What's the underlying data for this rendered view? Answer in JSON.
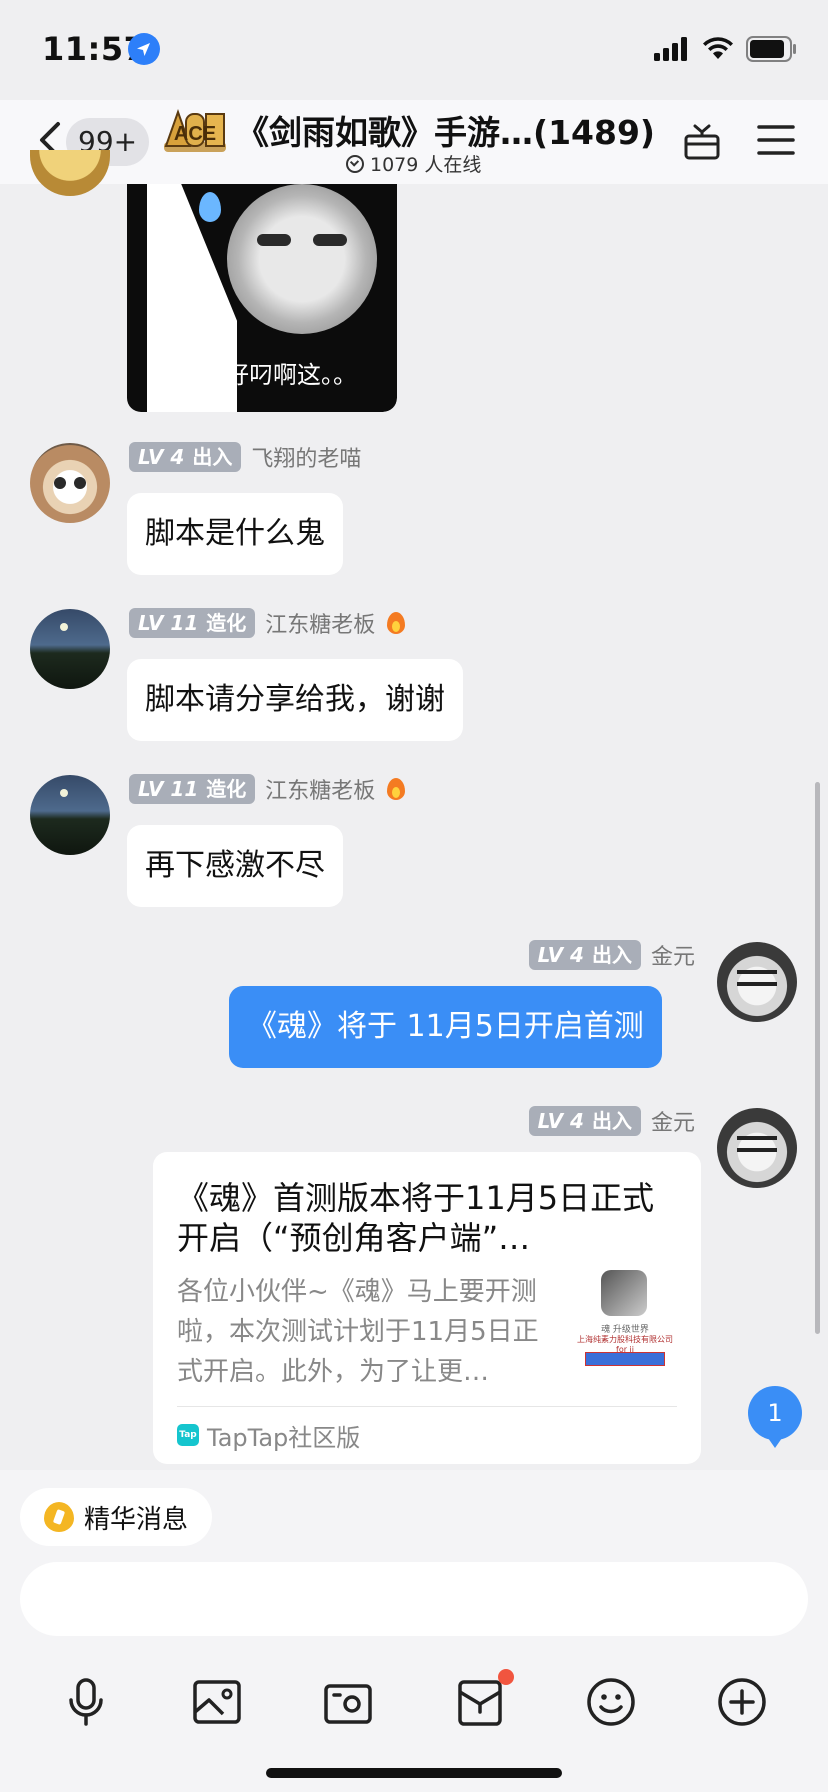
{
  "status_bar": {
    "time": "11:57"
  },
  "header": {
    "unread_count": "99+",
    "logo_text": "ACE",
    "title": "《剑雨如歌》手游…(1489)",
    "online_text": "1079 人在线"
  },
  "messages": [
    {
      "type": "sticker",
      "caption": "卧槽好叼啊这。。"
    },
    {
      "level": "LV 4",
      "title": "出入",
      "nickname": "飞翔的老喵",
      "text": "脚本是什么鬼"
    },
    {
      "level": "LV 11",
      "title": "造化",
      "nickname": "江东糖老板",
      "text": "脚本请分享给我，谢谢"
    },
    {
      "level": "LV 11",
      "title": "造化",
      "nickname": "江东糖老板",
      "text": "再下感激不尽"
    },
    {
      "level": "LV 4",
      "title": "出入",
      "nickname": "金元",
      "text": "《魂》将于 11月5日开启首测"
    },
    {
      "level": "LV 4",
      "title": "出入",
      "nickname": "金元",
      "card": {
        "title": "《魂》首测版本将于11月5日正式开启（“预创角客户端”…",
        "description": "各位小伙伴~《魂》马上要开测啦，本次测试计划于11月5日正式开启。此外，为了让更…",
        "thumb_line1": "魂 升级世界",
        "thumb_line2": "上海纯素力股科技有限公司 for ii",
        "source_icon": "Tap",
        "source": "TapTap社区版"
      }
    }
  ],
  "new_message_count": "1",
  "bottom": {
    "highlight_label": "精华消息",
    "input_placeholder": ""
  },
  "toolbar_icons": [
    "microphone-icon",
    "image-icon",
    "camera-icon",
    "gift-box-icon",
    "emoji-icon",
    "plus-circle-icon"
  ],
  "colors": {
    "accent": "#3a8ef6",
    "badge_gray": "#a9aeb8",
    "background": "#efeff1"
  }
}
